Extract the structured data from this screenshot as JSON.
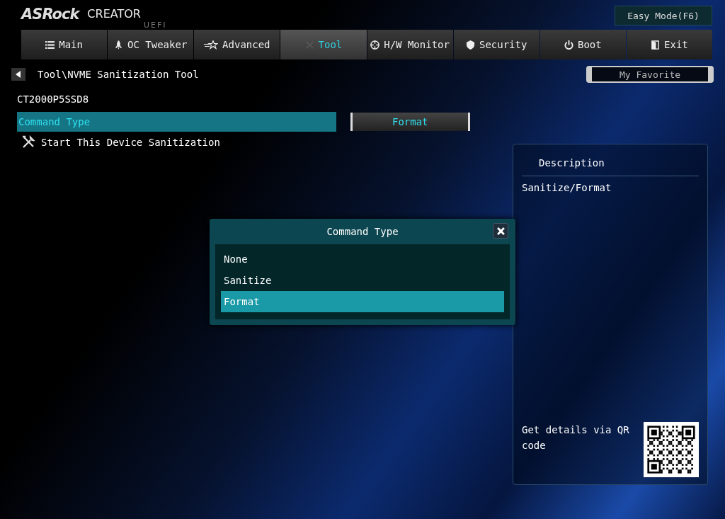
{
  "header": {
    "brand": "ASRock",
    "product": "CREATOR",
    "suffix": "UEFI",
    "mode_button": "Easy Mode(F6)"
  },
  "tabs": [
    {
      "label": "Main",
      "selected": false
    },
    {
      "label": "OC Tweaker",
      "selected": false
    },
    {
      "label": "Advanced",
      "selected": false
    },
    {
      "label": "Tool",
      "selected": true
    },
    {
      "label": "H/W Monitor",
      "selected": false
    },
    {
      "label": "Security",
      "selected": false
    },
    {
      "label": "Boot",
      "selected": false
    },
    {
      "label": "Exit",
      "selected": false
    }
  ],
  "breadcrumb": "Tool\\NVME Sanitization Tool",
  "favorite": "My Favorite",
  "device": "CT2000P5SSD8",
  "settings": [
    {
      "kind": "option",
      "label": "Command Type",
      "value": "Format",
      "selected": true
    },
    {
      "kind": "action",
      "label": "Start This Device Sanitization",
      "selected": false
    }
  ],
  "description": {
    "title": "Description",
    "text": "Sanitize/Format",
    "qr_text": "Get details via QR code"
  },
  "dialog": {
    "title": "Command Type",
    "options": [
      {
        "label": "None",
        "selected": false
      },
      {
        "label": "Sanitize",
        "selected": false
      },
      {
        "label": "Format",
        "selected": true
      }
    ]
  }
}
